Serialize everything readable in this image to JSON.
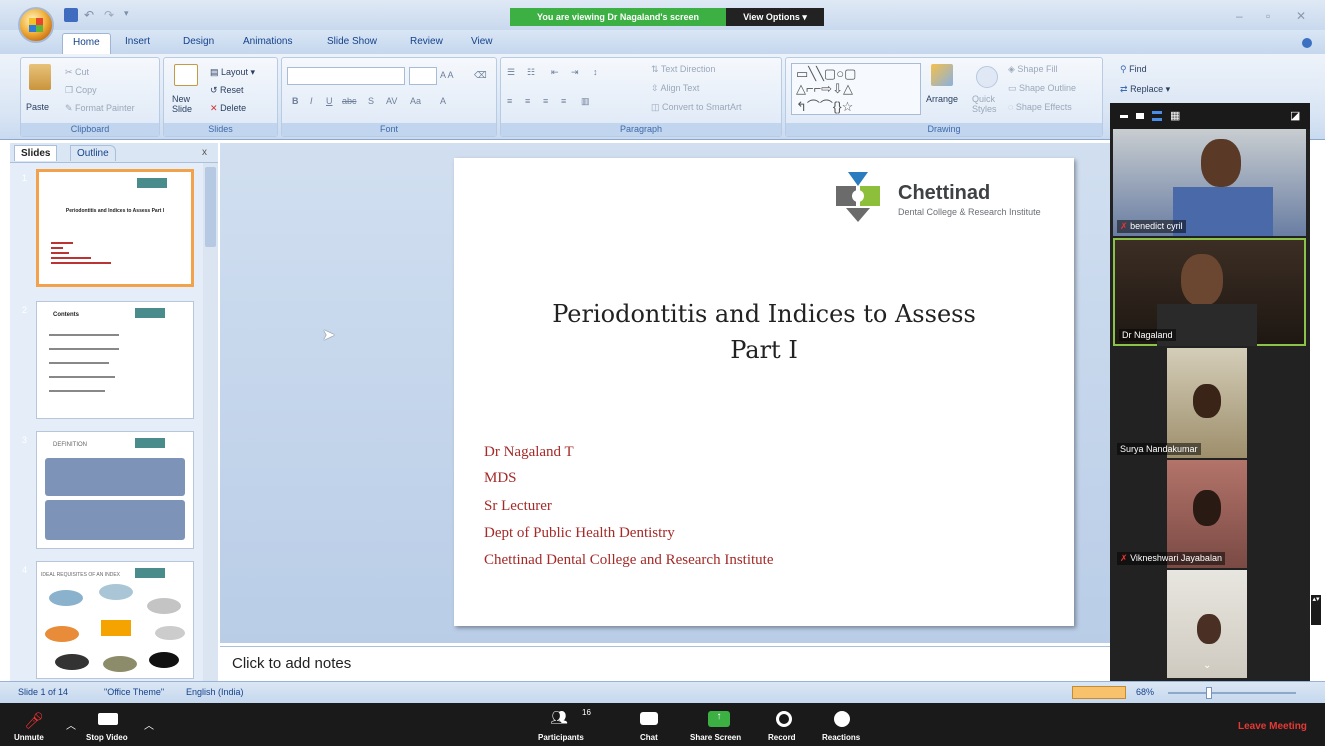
{
  "zoom": {
    "viewing_banner": "You are viewing Dr Nagaland's screen",
    "view_options": "View Options",
    "toolbar": {
      "unmute": "Unmute",
      "stop_video": "Stop Video",
      "participants": "Participants",
      "participants_count": "16",
      "chat": "Chat",
      "share_screen": "Share Screen",
      "record": "Record",
      "reactions": "Reactions",
      "leave": "Leave Meeting"
    },
    "participants": [
      {
        "name": "benedict cyril"
      },
      {
        "name": "Dr Nagaland"
      },
      {
        "name": "Surya Nandakumar"
      },
      {
        "name": "Vikneshwari Jayabalan"
      },
      {
        "name": ""
      }
    ]
  },
  "ppt": {
    "tabs": [
      "Home",
      "Insert",
      "Design",
      "Animations",
      "Slide Show",
      "Review",
      "View"
    ],
    "clipboard": {
      "paste": "Paste",
      "cut": "Cut",
      "copy": "Copy",
      "format_painter": "Format Painter",
      "label": "Clipboard"
    },
    "slides_group": {
      "new_slide": "New Slide",
      "layout": "Layout",
      "reset": "Reset",
      "delete": "Delete",
      "label": "Slides"
    },
    "font_group": {
      "label": "Font"
    },
    "paragraph_group": {
      "text_direction": "Text Direction",
      "align_text": "Align Text",
      "convert": "Convert to SmartArt",
      "label": "Paragraph"
    },
    "drawing_group": {
      "arrange": "Arrange",
      "quick_styles": "Quick Styles",
      "shape_fill": "Shape Fill",
      "shape_outline": "Shape Outline",
      "shape_effects": "Shape Effects",
      "label": "Drawing"
    },
    "editing_group": {
      "find": "Find",
      "replace": "Replace"
    },
    "pane_tabs": {
      "slides": "Slides",
      "outline": "Outline"
    },
    "thumb_numbers": [
      "1",
      "2",
      "3",
      "4"
    ],
    "thumb_titles": [
      "Periodontitis and Indices to Assess Part I",
      "Contents",
      "DEFINITION",
      "IDEAL REQUISITES OF AN INDEX"
    ],
    "slide": {
      "logo_name": "Chettinad",
      "logo_sub": "Dental College & Research Institute",
      "title_line1": "Periodontitis and Indices to Assess",
      "title_line2": "Part I",
      "author_lines": [
        "Dr Nagaland T",
        "MDS",
        "Sr Lecturer",
        "Dept of Public Health Dentistry",
        "Chettinad Dental College and Research Institute"
      ]
    },
    "notes_placeholder": "Click to add notes",
    "status": {
      "slide": "Slide 1 of 14",
      "theme": "\"Office Theme\"",
      "lang": "English (India)",
      "zoom": "68%"
    }
  }
}
